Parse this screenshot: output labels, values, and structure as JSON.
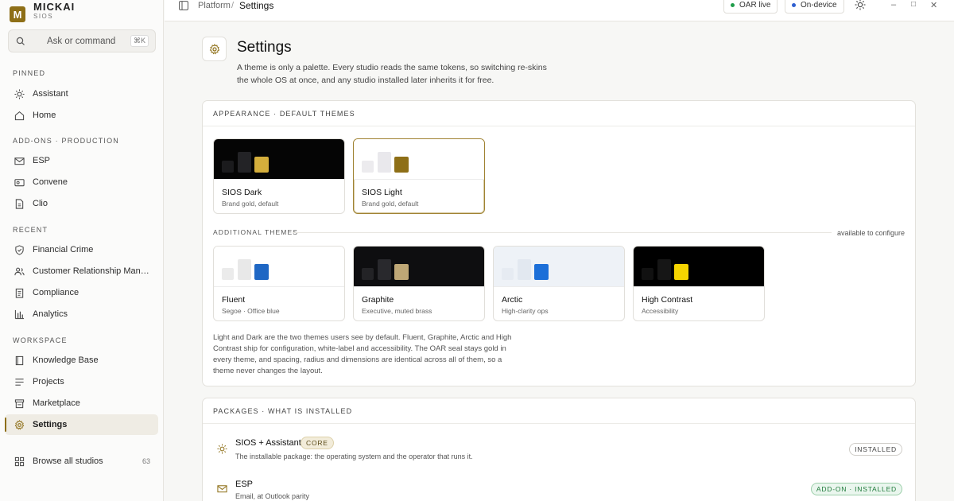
{
  "brand": {
    "name": "MICKAI",
    "sub": "SIOS",
    "logo_letter": "M"
  },
  "search": {
    "placeholder": "Ask or command",
    "shortcut": "⌘K"
  },
  "sidebar": {
    "pinned_label": "PINNED",
    "pinned": [
      {
        "label": "Assistant",
        "icon": "sun-icon"
      },
      {
        "label": "Home",
        "icon": "home-icon"
      }
    ],
    "addons_label": "ADD-ONS · PRODUCTION",
    "addons": [
      {
        "label": "ESP",
        "icon": "mail-icon"
      },
      {
        "label": "Convene",
        "icon": "video-icon"
      },
      {
        "label": "Clio",
        "icon": "document-icon"
      }
    ],
    "recent_label": "RECENT",
    "recent": [
      {
        "label": "Financial Crime",
        "icon": "shield-icon"
      },
      {
        "label": "Customer Relationship Management",
        "icon": "users-icon"
      },
      {
        "label": "Compliance",
        "icon": "clipboard-icon"
      },
      {
        "label": "Analytics",
        "icon": "bar-chart-icon"
      }
    ],
    "workspace_label": "WORKSPACE",
    "workspace": [
      {
        "label": "Knowledge Base",
        "icon": "book-icon"
      },
      {
        "label": "Projects",
        "icon": "list-icon"
      },
      {
        "label": "Marketplace",
        "icon": "store-icon"
      },
      {
        "label": "Settings",
        "icon": "gear-icon",
        "active": true
      }
    ],
    "browse": {
      "label": "Browse all studios",
      "count": "63"
    }
  },
  "topbar": {
    "breadcrumb_parent": "Platform",
    "breadcrumb_sep": "/",
    "breadcrumb_current": "Settings",
    "status_oar": "OAR live",
    "status_device": "On-device",
    "minimize": "–",
    "maximize": "□",
    "close": "✕"
  },
  "page": {
    "title": "Settings",
    "description": "A theme is only a palette. Every studio reads the same tokens, so switching re-skins the whole OS at once, and any studio installed later inherits it for free."
  },
  "appearance": {
    "header": "APPEARANCE · DEFAULT THEMES",
    "default_themes": [
      {
        "name": "SIOS Dark",
        "sub": "Brand gold, default",
        "selected": false
      },
      {
        "name": "SIOS Light",
        "sub": "Brand gold, default",
        "selected": true
      }
    ],
    "additional_label": "ADDITIONAL THEMES",
    "additional_right": "available to configure",
    "additional_themes": [
      {
        "name": "Fluent",
        "sub": "Segoe · Office blue"
      },
      {
        "name": "Graphite",
        "sub": "Executive, muted brass"
      },
      {
        "name": "Arctic",
        "sub": "High-clarity ops"
      },
      {
        "name": "High Contrast",
        "sub": "Accessibility"
      }
    ],
    "note": "Light and Dark are the two themes users see by default. Fluent, Graphite, Arctic and High Contrast ship for configuration, white-label and accessibility. The OAR seal stays gold in every theme, and spacing, radius and dimensions are identical across all of them, so a theme never changes the layout."
  },
  "packages": {
    "header": "PACKAGES · WHAT IS INSTALLED",
    "items": [
      {
        "name": "SIOS + Assistant",
        "tag": "CORE",
        "desc": "The installable package: the operating system and the operator that runs it.",
        "status": "INSTALLED"
      },
      {
        "name": "ESP",
        "desc": "Email, at Outlook parity",
        "status": "ADD-ON · INSTALLED"
      }
    ]
  },
  "colors": {
    "brand_gold": "#8e6f17",
    "oar_green": "#1f9d4a",
    "device_blue": "#2f5fd0",
    "addon_green": "#1e7a3a"
  }
}
